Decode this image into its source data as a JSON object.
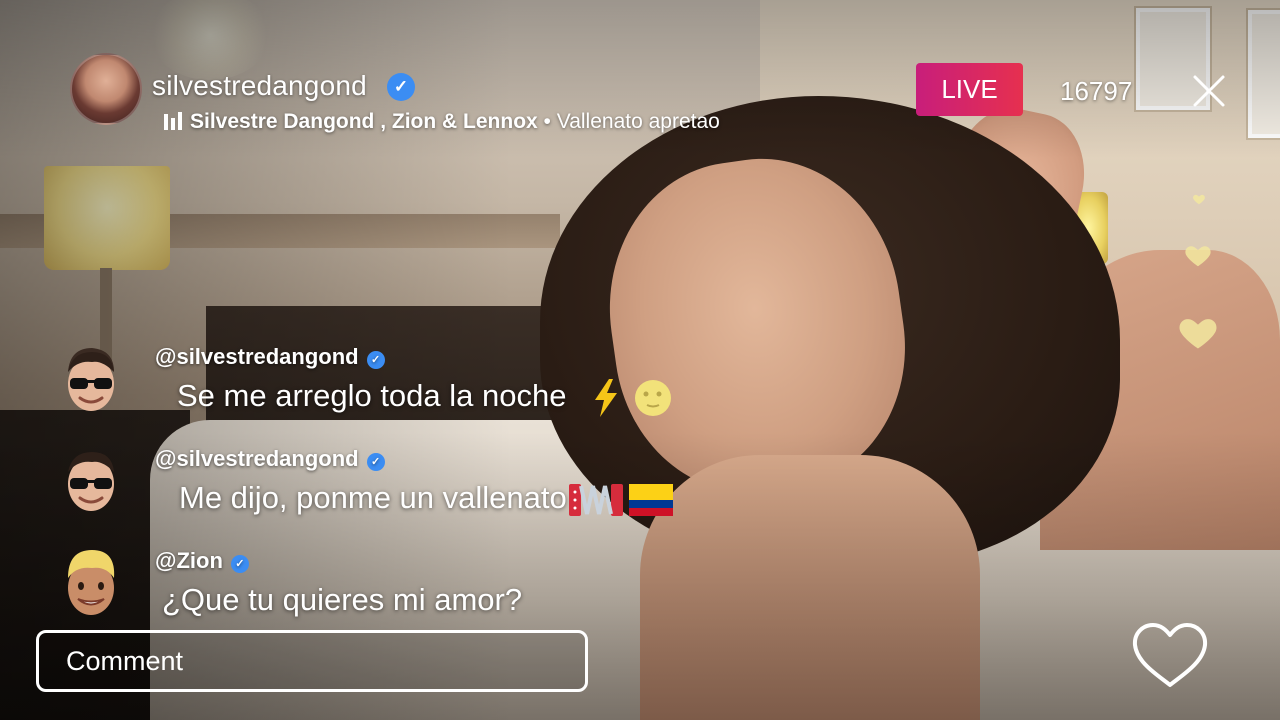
{
  "header": {
    "username": "silvestredangond",
    "music": {
      "artists": "Silvestre Dangond , Zion & Lennox",
      "separator": "•",
      "song": "Vallenato apretao"
    },
    "live_label": "LIVE",
    "viewer_count": "16797"
  },
  "comments": [
    {
      "user": "@silvestredangond",
      "verified": true,
      "text": "Se me arreglo toda la noche",
      "emojis": [
        "lightning-emoji",
        "full-moon-face-emoji"
      ]
    },
    {
      "user": "@silvestredangond",
      "verified": true,
      "text": "Me dijo, ponme un vallenato",
      "emojis": [
        "accordion-emoji",
        "colombia-flag-emoji"
      ]
    },
    {
      "user": "@Zion",
      "verified": true,
      "text": "¿Que tu quieres mi amor?",
      "emojis": []
    }
  ],
  "composer": {
    "placeholder": "Comment"
  },
  "icons": {
    "close": "close-icon",
    "like": "heart-outline-icon",
    "verified": "verified-badge-icon",
    "music": "music-bars-icon"
  },
  "colors": {
    "live_gradient_start": "#c81e7b",
    "live_gradient_end": "#e6304f",
    "verified": "#3b8df3"
  }
}
